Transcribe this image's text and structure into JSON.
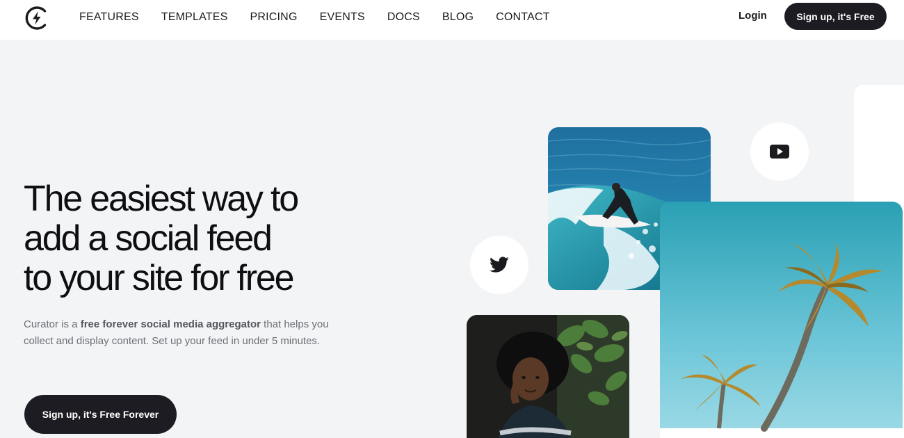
{
  "nav": {
    "logo_icon": "lightning-circle-icon",
    "links": [
      "FEATURES",
      "TEMPLATES",
      "PRICING",
      "EVENTS",
      "DOCS",
      "BLOG",
      "CONTACT"
    ],
    "login": "Login",
    "signup": "Sign up, it's Free"
  },
  "hero": {
    "title_lines": [
      "The easiest way to",
      "add a social feed",
      "to your site for free"
    ],
    "desc_pre": "Curator is a ",
    "desc_bold": "free forever social media aggregator",
    "desc_post": " that helps you collect and display content. Set up your feed in under 5 minutes.",
    "cta": "Sign up, it's Free Forever"
  },
  "collage": {
    "icons": [
      "youtube-icon",
      "twitter-icon"
    ],
    "images": [
      "surfer-photo",
      "woman-portrait-photo",
      "palm-trees-photo"
    ]
  },
  "colors": {
    "background": "#f3f4f6",
    "dark_button": "#1c1c22",
    "text_muted": "#6d6f76"
  }
}
